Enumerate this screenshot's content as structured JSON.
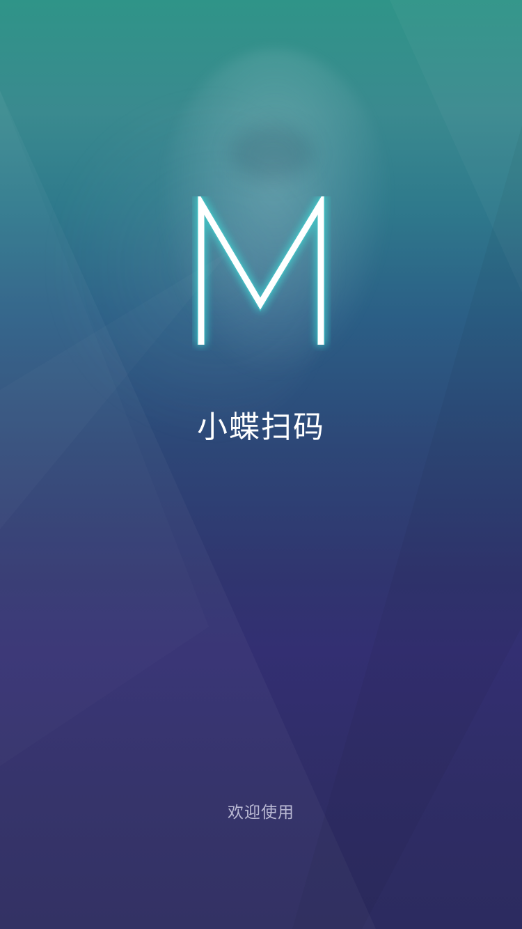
{
  "splash": {
    "logo_icon": "m-logo-icon",
    "logo_color": "#ffffff",
    "logo_glow_color": "#3fe3dc",
    "app_name": "小蝶扫码",
    "welcome_text": "欢迎使用"
  }
}
